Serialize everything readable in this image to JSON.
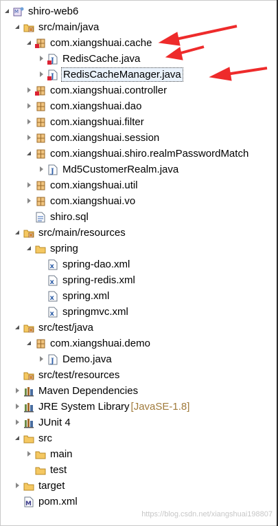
{
  "tree": [
    {
      "depth": 0,
      "tw": "exp",
      "icon": "project-icon",
      "label": "shiro-web6"
    },
    {
      "depth": 1,
      "tw": "exp",
      "icon": "source-folder-icon",
      "label": "src/main/java"
    },
    {
      "depth": 2,
      "tw": "exp",
      "icon": "package-error-icon",
      "label": "com.xiangshuai.cache"
    },
    {
      "depth": 3,
      "tw": "col",
      "icon": "java-file-error-icon",
      "label": "RedisCache.java"
    },
    {
      "depth": 3,
      "tw": "col",
      "icon": "java-file-error-icon",
      "label": "RedisCacheManager.java",
      "selected": true
    },
    {
      "depth": 2,
      "tw": "col",
      "icon": "package-error-icon",
      "label": "com.xiangshuai.controller"
    },
    {
      "depth": 2,
      "tw": "col",
      "icon": "package-icon",
      "label": "com.xiangshuai.dao"
    },
    {
      "depth": 2,
      "tw": "col",
      "icon": "package-icon",
      "label": "com.xiangshuai.filter"
    },
    {
      "depth": 2,
      "tw": "col",
      "icon": "package-icon",
      "label": "com.xiangshuai.session"
    },
    {
      "depth": 2,
      "tw": "exp",
      "icon": "package-icon",
      "label": "com.xiangshuai.shiro.realmPasswordMatch"
    },
    {
      "depth": 3,
      "tw": "col",
      "icon": "java-file-icon",
      "label": "Md5CustomerRealm.java"
    },
    {
      "depth": 2,
      "tw": "col",
      "icon": "package-icon",
      "label": "com.xiangshuai.util"
    },
    {
      "depth": 2,
      "tw": "col",
      "icon": "package-icon",
      "label": "com.xiangshuai.vo"
    },
    {
      "depth": 2,
      "tw": "none",
      "icon": "sql-file-icon",
      "label": "shiro.sql"
    },
    {
      "depth": 1,
      "tw": "exp",
      "icon": "source-folder-icon",
      "label": "src/main/resources"
    },
    {
      "depth": 2,
      "tw": "exp",
      "icon": "folder-icon",
      "label": "spring"
    },
    {
      "depth": 3,
      "tw": "none",
      "icon": "xml-file-icon",
      "label": "spring-dao.xml"
    },
    {
      "depth": 3,
      "tw": "none",
      "icon": "xml-file-icon",
      "label": "spring-redis.xml"
    },
    {
      "depth": 3,
      "tw": "none",
      "icon": "xml-file-icon",
      "label": "spring.xml"
    },
    {
      "depth": 3,
      "tw": "none",
      "icon": "xml-file-icon",
      "label": "springmvc.xml"
    },
    {
      "depth": 1,
      "tw": "exp",
      "icon": "source-folder-icon",
      "label": "src/test/java"
    },
    {
      "depth": 2,
      "tw": "exp",
      "icon": "package-icon",
      "label": "com.xiangshuai.demo"
    },
    {
      "depth": 3,
      "tw": "col",
      "icon": "java-file-icon",
      "label": "Demo.java"
    },
    {
      "depth": 1,
      "tw": "none",
      "icon": "source-folder-icon",
      "label": "src/test/resources"
    },
    {
      "depth": 1,
      "tw": "col",
      "icon": "library-icon",
      "label": "Maven Dependencies"
    },
    {
      "depth": 1,
      "tw": "col",
      "icon": "library-icon",
      "label": "JRE System Library",
      "decoration": "[JavaSE-1.8]"
    },
    {
      "depth": 1,
      "tw": "col",
      "icon": "library-icon",
      "label": "JUnit 4"
    },
    {
      "depth": 1,
      "tw": "exp",
      "icon": "folder-icon",
      "label": "src"
    },
    {
      "depth": 2,
      "tw": "col",
      "icon": "folder-icon",
      "label": "main"
    },
    {
      "depth": 2,
      "tw": "none",
      "icon": "folder-icon",
      "label": "test"
    },
    {
      "depth": 1,
      "tw": "col",
      "icon": "folder-icon",
      "label": "target"
    },
    {
      "depth": 1,
      "tw": "none",
      "icon": "pom-file-icon",
      "label": "pom.xml"
    }
  ],
  "watermark": "https://blog.csdn.net/xiangshuai198807",
  "colors": {
    "arrow": "#ee2b2b",
    "selection": "#eaf2fb",
    "decoration": "#a07a3a"
  }
}
